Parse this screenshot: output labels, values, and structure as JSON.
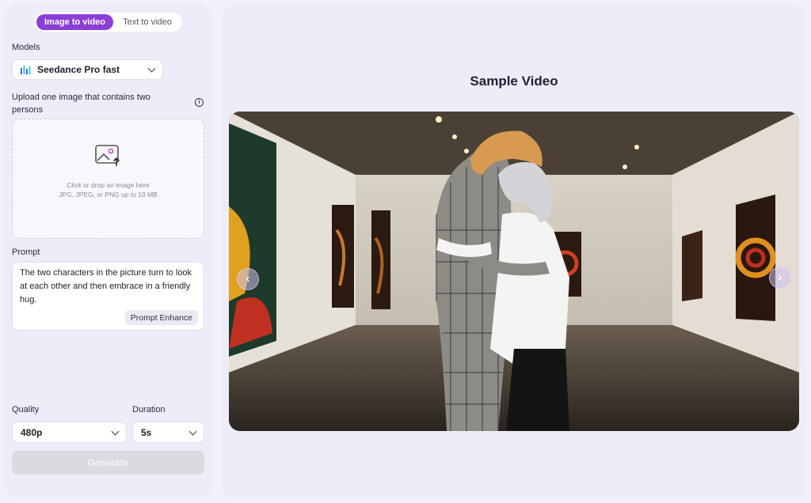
{
  "mode_toggle": {
    "image_to_video": "Image to video",
    "text_to_video": "Text to video"
  },
  "models": {
    "label": "Models",
    "selected": "Seedance Pro fast"
  },
  "upload": {
    "label": "Upload one image that contains two persons",
    "line1": "Click or drop an image here",
    "line2": "JPG, JPEG, or PNG up to 10 MB"
  },
  "prompt": {
    "label": "Prompt",
    "value": "The two characters in the picture turn to look at each other and then embrace in a friendly hug.",
    "enhance_label": "Prompt Enhance"
  },
  "quality": {
    "label": "Quality",
    "selected": "480p"
  },
  "duration": {
    "label": "Duration",
    "selected": "5s"
  },
  "generate_label": "Generate",
  "sample": {
    "title": "Sample Video"
  },
  "colors": {
    "accent": "#8a3fd6",
    "panel": "#efecf9",
    "page": "#f3f0fb"
  },
  "icons": {
    "model": "bar-chart-icon",
    "upload": "image-upload-icon",
    "info": "info-icon",
    "prev": "chevron-left-icon",
    "next": "chevron-right-icon"
  }
}
